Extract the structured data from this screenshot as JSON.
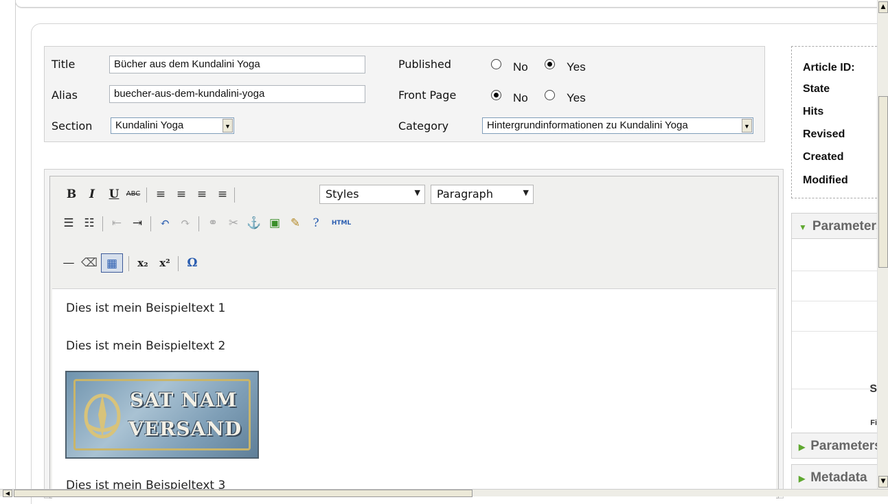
{
  "details": {
    "title_label": "Title",
    "title_value": "Bücher aus dem Kundalini Yoga",
    "alias_label": "Alias",
    "alias_value": "buecher-aus-dem-kundalini-yoga",
    "section_label": "Section",
    "section_value": "Kundalini Yoga",
    "published_label": "Published",
    "published_no": "No",
    "published_yes": "Yes",
    "published_selected": "Yes",
    "frontpage_label": "Front Page",
    "frontpage_no": "No",
    "frontpage_yes": "Yes",
    "frontpage_selected": "No",
    "category_label": "Category",
    "category_value": "Hintergrundinformationen zu Kundalini Yoga"
  },
  "info": {
    "article_id": "Article ID:",
    "state": "State",
    "hits": "Hits",
    "revised": "Revised",
    "created": "Created",
    "modified": "Modified"
  },
  "toolbar": {
    "bold": "B",
    "italic": "I",
    "underline": "U",
    "strike": "ABC",
    "styles": "Styles",
    "paragraph": "Paragraph",
    "html": "HTML",
    "omega": "Ω",
    "sub": "x₂",
    "sup": "x²"
  },
  "content": {
    "p1": "Dies ist mein Beispieltext 1",
    "p2": "Dies ist mein Beispieltext 2",
    "banner_line1": "SAT NAM",
    "banner_line2": "VERSAND",
    "p3": "Dies ist mein Beispieltext 3"
  },
  "sidebar": {
    "panel1": "Parameters",
    "panel2": "Parameters",
    "panel3": "Metadata",
    "row_char1": "S",
    "row_char2": "Fi"
  }
}
